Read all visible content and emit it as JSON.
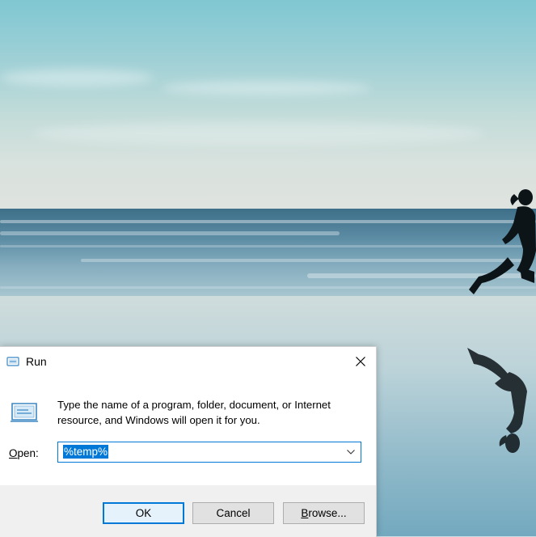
{
  "dialog": {
    "title": "Run",
    "description": "Type the name of a program, folder, document, or Internet resource, and Windows will open it for you.",
    "open_label_first": "O",
    "open_label_rest": "pen:",
    "input_value": "%temp%",
    "ok_label": "OK",
    "cancel_label": "Cancel",
    "browse_label_first": "B",
    "browse_label_rest": "rowse...",
    "icons": {
      "title": "run-icon",
      "body": "run-icon",
      "close": "close-icon",
      "dropdown": "chevron-down-icon"
    }
  },
  "colors": {
    "accent": "#0078d7",
    "footer_bg": "#f0f0f0",
    "button_bg": "#e1e1e1"
  }
}
